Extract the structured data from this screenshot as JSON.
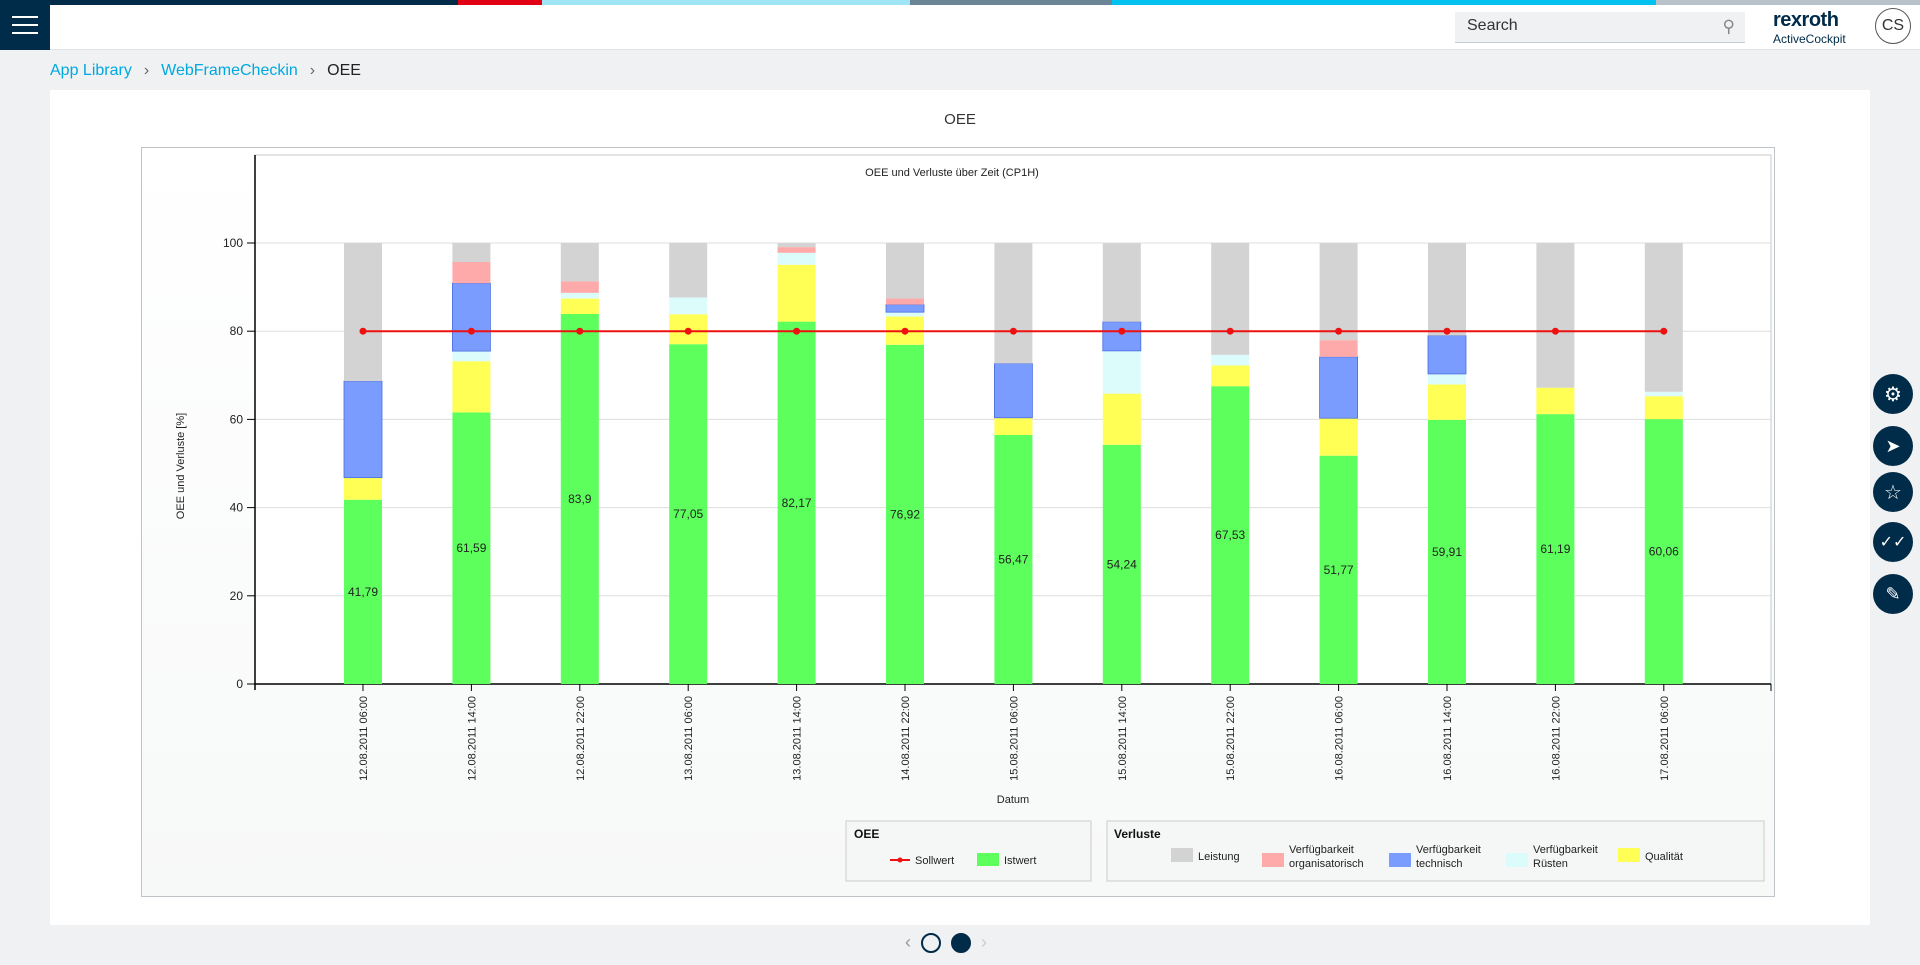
{
  "header": {
    "search_placeholder": "Search",
    "brand": "rexroth",
    "product": "ActiveCockpit",
    "user_initials": "CS",
    "stripe_colors": [
      "#002b49",
      "#e20015",
      "#9ee6f5",
      "#6c8596",
      "#00c1ef",
      "#b8c2c8"
    ]
  },
  "breadcrumb": [
    "App Library",
    "WebFrameCheckin",
    "OEE"
  ],
  "card": {
    "title": "OEE"
  },
  "side_actions": [
    "gear-icon",
    "send-icon",
    "star-icon",
    "check-double-icon",
    "edit-document-icon"
  ],
  "pager": {
    "pages": 2,
    "current": 2
  },
  "chart_data": {
    "type": "bar",
    "stacked": true,
    "title": "OEE und Verluste über Zeit (CP1H)",
    "xlabel": "Datum",
    "ylabel": "OEE und Verluste [%]",
    "ylim": [
      0,
      120
    ],
    "yticks": [
      0,
      20,
      40,
      60,
      80,
      100
    ],
    "grid": true,
    "legend_placement": "bottom-right",
    "categories": [
      "12.08.2011 06:00",
      "12.08.2011 14:00",
      "12.08.2011 22:00",
      "13.08.2011 06:00",
      "13.08.2011 14:00",
      "14.08.2011 22:00",
      "15.08.2011 06:00",
      "15.08.2011 14:00",
      "15.08.2011 22:00",
      "16.08.2011 06:00",
      "16.08.2011 14:00",
      "16.08.2011 22:00",
      "17.08.2011 06:00"
    ],
    "legend_groups": [
      {
        "title": "OEE",
        "items": [
          "Sollwert",
          "Istwert"
        ]
      },
      {
        "title": "Verluste",
        "items": [
          "Leistung",
          "Verfügbarkeit organisatorisch",
          "Verfügbarkeit technisch",
          "Verfügbarkeit Rüsten",
          "Qualität"
        ]
      }
    ],
    "series": [
      {
        "name": "Istwert",
        "color": "#5cff5c",
        "values": [
          41.79,
          61.59,
          83.9,
          77.05,
          82.17,
          76.92,
          56.47,
          54.24,
          67.53,
          51.77,
          59.91,
          61.19,
          60.06
        ],
        "labels": [
          "41,79",
          "61,59",
          "83,9",
          "77,05",
          "82,17",
          "76,92",
          "56,47",
          "54,24",
          "67,53",
          "51,77",
          "59,91",
          "61,19",
          "60,06"
        ]
      },
      {
        "name": "Qualität",
        "color": "#ffff55",
        "values": [
          5.0,
          11.6,
          3.5,
          6.8,
          12.9,
          6.4,
          3.9,
          11.6,
          4.7,
          8.5,
          8.0,
          6.0,
          5.2
        ]
      },
      {
        "name": "Verfügbarkeit Rüsten",
        "color": "#dcfcfc",
        "values": [
          0,
          2.3,
          1.3,
          3.8,
          2.7,
          1.0,
          0,
          9.7,
          2.4,
          0,
          2.4,
          0,
          1.0
        ]
      },
      {
        "name": "Verfügbarkeit technisch",
        "color": "#7b9cff",
        "values": [
          21.9,
          15.4,
          0,
          0,
          0,
          1.7,
          12.3,
          6.6,
          0,
          13.9,
          8.7,
          0,
          0
        ]
      },
      {
        "name": "Verfügbarkeit organisatorisch",
        "color": "#ffaaaa",
        "values": [
          0,
          4.8,
          2.6,
          0,
          1.3,
          1.4,
          0,
          0,
          0,
          3.8,
          0,
          0,
          0
        ]
      },
      {
        "name": "Leistung",
        "color": "#d3d3d3",
        "values": [
          31.3,
          4.3,
          8.7,
          12.4,
          0.9,
          12.6,
          27.3,
          17.8,
          25.4,
          22.0,
          21.0,
          32.8,
          33.7
        ]
      }
    ],
    "line": {
      "name": "Sollwert",
      "color": "#ee1111",
      "values": [
        80,
        80,
        80,
        80,
        80,
        80,
        80,
        80,
        80,
        80,
        80,
        80,
        80
      ]
    }
  }
}
